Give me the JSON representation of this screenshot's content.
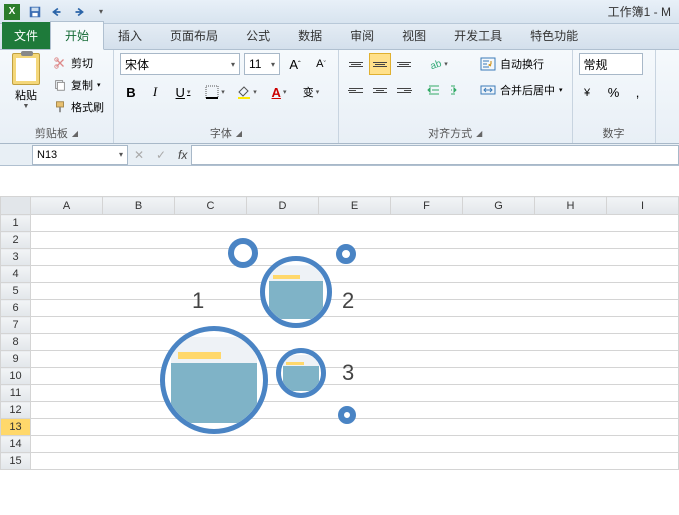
{
  "titlebar": {
    "title": "工作簿1 - M"
  },
  "tabs": {
    "file": "文件",
    "home": "开始",
    "insert": "插入",
    "layout": "页面布局",
    "formula": "公式",
    "data": "数据",
    "review": "审阅",
    "view": "视图",
    "dev": "开发工具",
    "special": "特色功能"
  },
  "clipboard": {
    "paste": "粘贴",
    "cut": "剪切",
    "copy": "复制",
    "format": "格式刷",
    "group": "剪贴板"
  },
  "font": {
    "name": "宋体",
    "size": "11",
    "group": "字体",
    "bold": "B",
    "italic": "I",
    "underline": "U",
    "incA": "A",
    "decA": "A",
    "wen": "变"
  },
  "align": {
    "wrap": "自动换行",
    "merge": "合并后居中",
    "group": "对齐方式"
  },
  "number": {
    "format": "常规",
    "group": "数字",
    "percent": "%",
    "comma": ","
  },
  "namebox": {
    "ref": "N13"
  },
  "cols": [
    "A",
    "B",
    "C",
    "D",
    "E",
    "F",
    "G",
    "H",
    "I"
  ],
  "rows": [
    "1",
    "2",
    "3",
    "4",
    "5",
    "6",
    "7",
    "8",
    "9",
    "10",
    "11",
    "12",
    "13",
    "14",
    "15"
  ],
  "selected_row": "13",
  "overlay_nums": {
    "n1": "1",
    "n2": "2",
    "n3": "3"
  }
}
